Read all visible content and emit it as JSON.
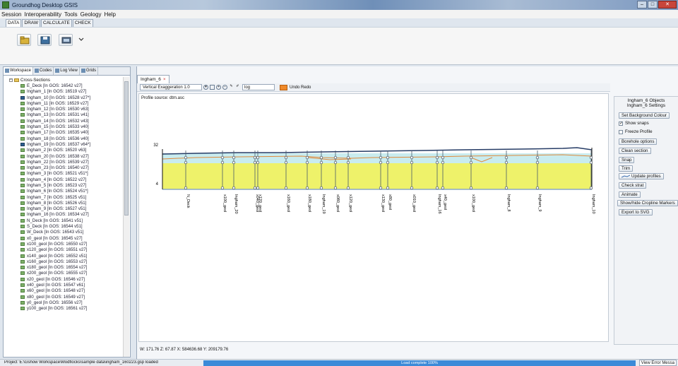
{
  "window": {
    "title": "Groundhog Desktop GSIS"
  },
  "menu": [
    "Session",
    "Interoperability",
    "Tools",
    "Geology",
    "Help"
  ],
  "mode_tabs": [
    "DATA",
    "DRAW",
    "CALCULATE",
    "CHECK"
  ],
  "left_panel": {
    "tabs": [
      "Workspace",
      "Codes",
      "Log View",
      "Grids"
    ],
    "tree_root": "Cross-Sections",
    "items": [
      "E_Deck [In GOS: 16542 v27]",
      "Ingham_1 [In GOS: 16519 v27]",
      "Ingham_10 [In GOS: 16528 v27*]",
      "Ingham_11 [In GOS: 16529 v27]",
      "Ingham_12 [In GOS: 16530 v63]",
      "Ingham_13 [In GOS: 16531 v41]",
      "Ingham_14 [In GOS: 16532 v43]",
      "Ingham_15 [In GOS: 16533 v40]",
      "Ingham_17 [In GOS: 16535 v40]",
      "Ingham_18 [In GOS: 16536 v40]",
      "Ingham_19 [In GOS: 16537 v64*]",
      "Ingham_2 [In GOS: 16520 v63]",
      "Ingham_20 [In GOS: 16538 v27]",
      "Ingham_22 [In GOS: 16539 v27]",
      "Ingham_23 [In GOS: 16540 v27]",
      "Ingham_3 [In GOS: 16521 v51*]",
      "Ingham_4 [In GOS: 16522 v27]",
      "Ingham_5 [In GOS: 16523 v27]",
      "Ingham_6 [In GOS: 16524 v51*]",
      "Ingham_7 [In GOS: 16525 v51]",
      "Ingham_8 [In GOS: 16526 v51]",
      "Ingham_9 [In GOS: 16527 v51]",
      "Ingham_16 [In GOS: 16534 v27]",
      "N_Deck [In GOS: 16541 v51]",
      "S_Deck [In GOS: 16544 v51]",
      "W_Deck [In GOS: 16543 v51]",
      "x0_geol [In GOS: 16545 v27]",
      "x100_geol [In GOS: 16550 v27]",
      "x120_geol [In GOS: 16551 v27]",
      "x140_geol [In GOS: 16552 v51]",
      "x160_geol [In GOS: 16553 v27]",
      "x180_geol [In GOS: 16554 v27]",
      "x200_geol [In GOS: 16555 v27]",
      "x20_geol [In GOS: 16546 v27]",
      "x40_geol [In GOS: 16547 v61]",
      "x60_geol [In GOS: 16548 v27]",
      "x80_geol [In GOS: 16549 v27]",
      "y0_geol [In GOS: 16556 v27]",
      "y100_geol [In GOS: 16561 v27]"
    ]
  },
  "document": {
    "tab_label": "Ingham_6",
    "vertical_exaggeration": "Vertical Exaggeration 1.0",
    "mode_value": "log",
    "undo_label": "Undo Redo",
    "profile_source": "Profile source: dtm.asc",
    "axis_top": "32",
    "axis_bottom": "4",
    "coords": "W: 171.76 Z: 67.87 X: 584636.68 Y: 209179.76"
  },
  "boreholes": [
    "N_Deck",
    "x100_geol",
    "Ingham_20",
    "x040_geol",
    "x120_geol",
    "x160_geol",
    "x180_geol",
    "Ingham_19",
    "x080_geol",
    "x120_geol",
    "x130_geol",
    "x80_geol",
    "x010_geol",
    "Ingham_16",
    "x40_geol",
    "x100_geol",
    "Ingham_8",
    "Ingham_9",
    "Ingham_10"
  ],
  "right_panel": {
    "header1": "Ingham_6 Objects",
    "header2": "Ingham_6 Settings",
    "set_background": "Set Background Colour",
    "show_snaps": "Show snaps",
    "freeze_profile": "Freeze Profile",
    "borehole_options": "Borehole options",
    "clean_section": "Clean section",
    "snap": "Snap",
    "trim": "Trim",
    "update_profiles": "Update profiles",
    "check_strat": "Check strat",
    "animate": "Animate",
    "show_hide_cropline": "Show/hide Cropline Markers",
    "export_svg": "Export to SVG"
  },
  "status": {
    "left": "Project 'E:\\Gshow Workspace\\Modflocks\\sample data\\ingham_160223.gsp loaded",
    "progress": "Load complete 100%",
    "button": "View Error Messa"
  },
  "colors": {
    "strata_fill": "#eef26a",
    "water_band": "#c9ecef",
    "surface_line": "#263c66",
    "orange_line": "#e08a3c",
    "progress": "#3b8ad8"
  }
}
